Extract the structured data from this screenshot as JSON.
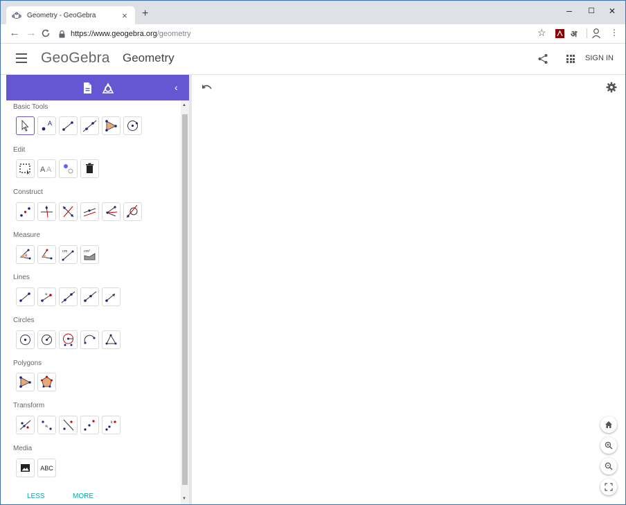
{
  "browser": {
    "tab_title": "Geometry - GeoGebra",
    "tab_close": "×",
    "new_tab": "+",
    "url_host": "https://www.geogebra.org",
    "url_path": "/geometry",
    "controls": {
      "minimize": "–",
      "maximize": "☐",
      "close": "✕"
    },
    "nav": {
      "back": "←",
      "forward": "→",
      "reload": "C"
    },
    "extensions": {
      "star": "☆",
      "hindi": "अ",
      "menu": "⋮"
    }
  },
  "header": {
    "menu_icon": "hamburger-icon",
    "logo": "GeoGebra",
    "app_title": "Geometry",
    "sign_in": "SIGN IN"
  },
  "sidebar": {
    "collapse": "‹",
    "sections": [
      {
        "label": "Basic Tools",
        "tools": [
          "move-icon",
          "point-icon",
          "segment-icon",
          "line-icon",
          "polygon-icon",
          "circle-center-point-icon"
        ]
      },
      {
        "label": "Edit",
        "tools": [
          "select-objects-icon",
          "text-style-icon",
          "show-hide-icon",
          "delete-icon"
        ]
      },
      {
        "label": "Construct",
        "tools": [
          "midpoint-icon",
          "perpendicular-line-icon",
          "perpendicular-bisector-icon",
          "parallel-line-icon",
          "angle-bisector-icon",
          "tangents-icon"
        ]
      },
      {
        "label": "Measure",
        "tools": [
          "angle-icon",
          "angle-given-size-icon",
          "distance-length-icon",
          "area-icon"
        ]
      },
      {
        "label": "Lines",
        "tools": [
          "segment-icon",
          "segment-fixed-length-icon",
          "line-icon",
          "ray-icon",
          "vector-icon"
        ]
      },
      {
        "label": "Circles",
        "tools": [
          "circle-center-point-icon",
          "compass-icon",
          "circle-three-points-icon",
          "semicircle-icon",
          "circumcircular-arc-icon"
        ]
      },
      {
        "label": "Polygons",
        "tools": [
          "polygon-icon",
          "regular-polygon-icon"
        ]
      },
      {
        "label": "Transform",
        "tools": [
          "reflect-line-icon",
          "reflect-point-icon",
          "reflect-circle-icon",
          "rotate-icon",
          "dilate-icon"
        ]
      },
      {
        "label": "Media",
        "tools": [
          "image-icon",
          "text-icon"
        ]
      }
    ],
    "text_tool_label": "ABC",
    "less": "LESS",
    "more": "MORE"
  },
  "colors": {
    "accent": "#6557d2",
    "point": "#1a237e",
    "red": "#cc0000",
    "teal": "#00a8a8"
  }
}
